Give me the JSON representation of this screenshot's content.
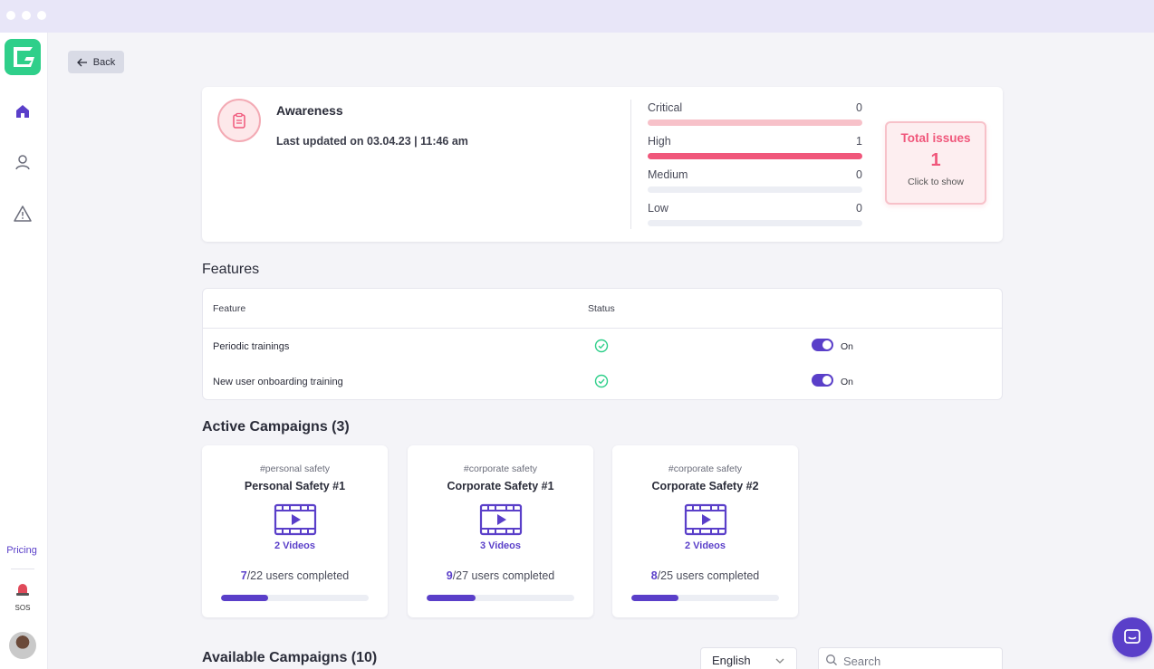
{
  "nav": {
    "back_label": "Back",
    "pricing_label": "Pricing",
    "sos_label": "SOS"
  },
  "summary": {
    "title": "Awareness",
    "last_updated": "Last updated on 03.04.23 | 11:46 am",
    "severities": [
      {
        "label": "Critical",
        "count": "0",
        "color": "#f7c1c9",
        "fill": 1.0
      },
      {
        "label": "High",
        "count": "1",
        "color": "#f0577b",
        "fill": 1.0
      },
      {
        "label": "Medium",
        "count": "0",
        "color": "#eceef4",
        "fill": 1.0
      },
      {
        "label": "Low",
        "count": "0",
        "color": "#eceef4",
        "fill": 1.0
      }
    ],
    "total_title": "Total issues",
    "total_count": "1",
    "total_hint": "Click to show"
  },
  "features": {
    "section_title": "Features",
    "col_feature": "Feature",
    "col_status": "Status",
    "rows": [
      {
        "name": "Periodic trainings",
        "toggle_label": "On",
        "enabled": true
      },
      {
        "name": "New user onboarding training",
        "toggle_label": "On",
        "enabled": true
      }
    ]
  },
  "active_campaigns": {
    "section_title": "Active Campaigns (3)",
    "items": [
      {
        "tag": "#personal safety",
        "name": "Personal Safety #1",
        "videos": "2 Videos",
        "completed": "7",
        "total_text": "/22 users completed",
        "progress": 0.32
      },
      {
        "tag": "#corporate safety",
        "name": "Corporate Safety #1",
        "videos": "3 Videos",
        "completed": "9",
        "total_text": "/27 users completed",
        "progress": 0.33
      },
      {
        "tag": "#corporate safety",
        "name": "Corporate Safety #2",
        "videos": "2 Videos",
        "completed": "8",
        "total_text": "/25 users completed",
        "progress": 0.32
      }
    ]
  },
  "available_campaigns": {
    "section_title": "Available Campaigns (10)",
    "language": "English",
    "search_placeholder": "Search"
  },
  "colors": {
    "accent": "#5a3fc9",
    "brand": "#2fcf8a",
    "alert": "#f0577b",
    "success": "#2fcf8a"
  }
}
